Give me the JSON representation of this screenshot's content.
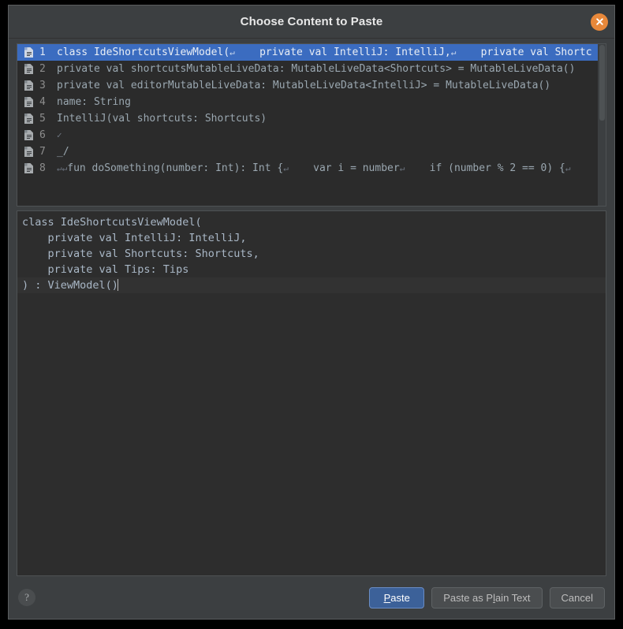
{
  "dialog": {
    "title": "Choose Content to Paste",
    "close_icon": "close-icon",
    "close_label": "Close"
  },
  "list": {
    "icon_name": "clipboard-entry-icon",
    "selected_index": 0,
    "rows": [
      {
        "num": "1",
        "segments": [
          {
            "t": "class IdeShortcutsViewModel(",
            "k": "code"
          },
          {
            "t": "↵",
            "k": "pilcrow"
          },
          {
            "t": "    private val IntelliJ: IntelliJ,",
            "k": "code"
          },
          {
            "t": "↵",
            "k": "pilcrow"
          },
          {
            "t": "    private val Shortc",
            "k": "code"
          }
        ]
      },
      {
        "num": "2",
        "segments": [
          {
            "t": "private val shortcutsMutableLiveData: MutableLiveData<Shortcuts> = MutableLiveData()",
            "k": "code"
          }
        ]
      },
      {
        "num": "3",
        "segments": [
          {
            "t": "private val editorMutableLiveData: MutableLiveData<IntelliJ> = MutableLiveData()",
            "k": "code"
          }
        ]
      },
      {
        "num": "4",
        "segments": [
          {
            "t": "name: String",
            "k": "code"
          }
        ]
      },
      {
        "num": "5",
        "segments": [
          {
            "t": "IntelliJ(val shortcuts: Shortcuts)",
            "k": "code"
          }
        ]
      },
      {
        "num": "6",
        "segments": [
          {
            "t": "✓",
            "k": "pilcrow"
          }
        ]
      },
      {
        "num": "7",
        "segments": [
          {
            "t": "_/",
            "k": "code"
          }
        ]
      },
      {
        "num": "8",
        "segments": [
          {
            "t": "↵↵",
            "k": "pilcrow"
          },
          {
            "t": "fun doSomething(number: Int): Int {",
            "k": "code"
          },
          {
            "t": "↵",
            "k": "pilcrow"
          },
          {
            "t": "    var i = number",
            "k": "code"
          },
          {
            "t": "↵",
            "k": "pilcrow"
          },
          {
            "t": "    if (number % 2 == 0) {",
            "k": "code"
          },
          {
            "t": "↵",
            "k": "pilcrow"
          }
        ]
      }
    ]
  },
  "preview": {
    "lines": [
      "class IdeShortcutsViewModel(",
      "    private val IntelliJ: IntelliJ,",
      "    private val Shortcuts: Shortcuts,",
      "    private val Tips: Tips",
      ") : ViewModel()"
    ],
    "caret_line_index": 4
  },
  "footer": {
    "help_label": "?",
    "buttons": [
      {
        "name": "paste-button",
        "pre": "",
        "mn": "P",
        "post": "aste",
        "default": true
      },
      {
        "name": "paste-as-plain-text-button",
        "pre": "Paste as P",
        "mn": "l",
        "post": "ain Text",
        "default": false
      },
      {
        "name": "cancel-button",
        "pre": "Cancel",
        "mn": "",
        "post": "",
        "default": false
      }
    ]
  },
  "colors": {
    "dialog_bg": "#3c3f41",
    "list_bg": "#2b2b2b",
    "preview_bg": "#2d2d2d",
    "selection_blue": "#3b6cc0",
    "code_fg": "#a9b7c6",
    "close_orange": "#e8883a",
    "default_button_blue": "#3c6199"
  }
}
